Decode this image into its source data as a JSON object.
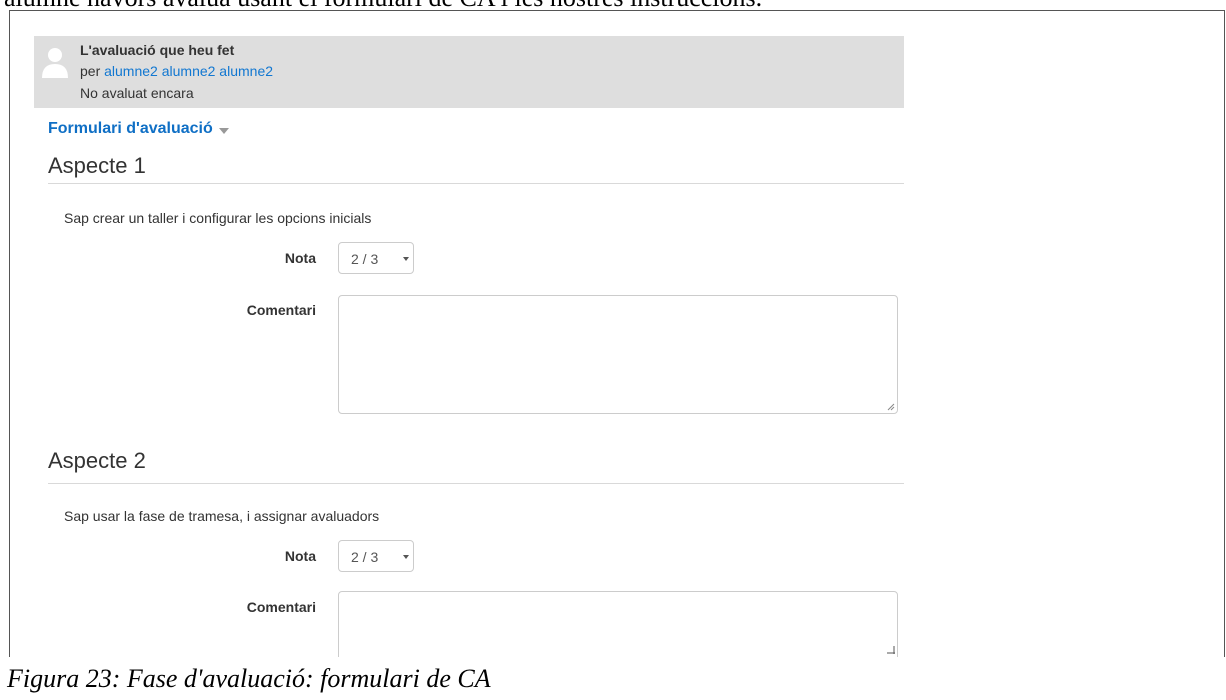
{
  "document": {
    "top_text": "alumne havors avalua usant el formulari de CA i les nostres instruccions.",
    "caption": "Figura 23: Fase d'avaluació: formulari de CA"
  },
  "assessment": {
    "title": "L'avaluació que heu fet",
    "by_prefix": "per",
    "author": "alumne2 alumne2 alumne2",
    "status": "No avaluat encara"
  },
  "form": {
    "title": "Formulari d'avaluació",
    "aspects": [
      {
        "title": "Aspecte 1",
        "description": "Sap crear un taller i configurar les opcions inicials",
        "grade_label": "Nota",
        "grade_value": "2 / 3",
        "comment_label": "Comentari",
        "comment_value": ""
      },
      {
        "title": "Aspecte 2",
        "description": "Sap usar la fase de tramesa, i assignar avaluadors",
        "grade_label": "Nota",
        "grade_value": "2 / 3",
        "comment_label": "Comentari",
        "comment_value": ""
      }
    ]
  },
  "icons": {
    "avatar": "user-avatar-icon",
    "collapse": "chevron-down-icon",
    "select_arrow": "caret-down-icon",
    "resize": "resize-grip-icon"
  },
  "colors": {
    "link": "#1177d1",
    "heading_link": "#0f6fc5",
    "header_bg": "#dedede"
  }
}
